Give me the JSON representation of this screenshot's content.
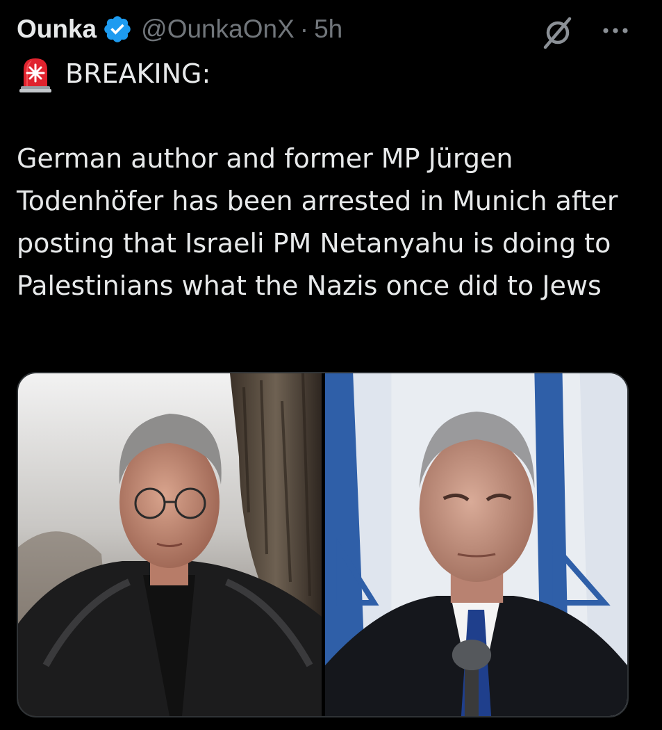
{
  "tweet": {
    "author_name": "Ounka",
    "handle": "@OunkaOnX",
    "separator": "·",
    "time": "5h",
    "breaking_label": "BREAKING:",
    "body": "German author and former MP Jürgen Todenhöfer has been arrested in Munich after posting that Israeli PM Netanyahu is doing to Palestinians what the Nazis once did to Jews"
  },
  "icons": {
    "verified": "verified-badge-icon",
    "grok": "grok-icon",
    "more": "more-icon",
    "siren": "siren-emoji"
  },
  "colors": {
    "background": "#000000",
    "text": "#e7e9ea",
    "muted": "#71767b",
    "verified": "#1d9bf0",
    "border": "#2f3336"
  }
}
